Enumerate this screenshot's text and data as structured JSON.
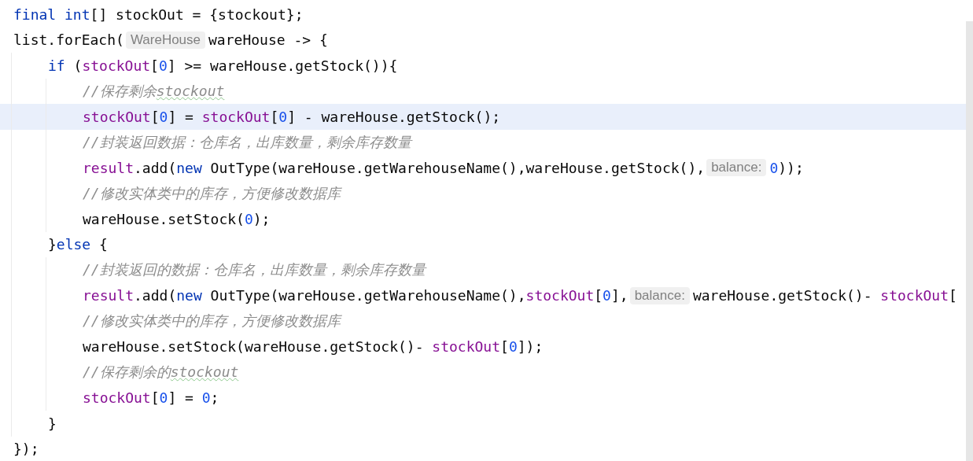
{
  "editor": {
    "lines": [
      {
        "current": false,
        "tokens": [
          {
            "kind": "keyword",
            "text": "final int"
          },
          {
            "kind": "plain",
            "text": "[] stockOut = {stockout};"
          }
        ]
      },
      {
        "current": false,
        "tokens": [
          {
            "kind": "plain",
            "text": "list.forEach("
          },
          {
            "kind": "hint",
            "text": "WareHouse"
          },
          {
            "kind": "plain",
            "text": "wareHouse -> {"
          }
        ],
        "children": [
          {
            "current": false,
            "tokens": [
              {
                "kind": "keyword",
                "text": "if"
              },
              {
                "kind": "plain",
                "text": " ("
              },
              {
                "kind": "field",
                "text": "stockOut"
              },
              {
                "kind": "plain",
                "text": "["
              },
              {
                "kind": "number",
                "text": "0"
              },
              {
                "kind": "plain",
                "text": "] >= wareHouse.getStock()){"
              }
            ],
            "children": [
              {
                "current": false,
                "tokens": [
                  {
                    "kind": "comment",
                    "text": "//保存剩余"
                  },
                  {
                    "kind": "typo",
                    "text": "stockout"
                  }
                ]
              },
              {
                "current": true,
                "tokens": [
                  {
                    "kind": "field",
                    "text": "stockOut"
                  },
                  {
                    "kind": "plain",
                    "text": "["
                  },
                  {
                    "kind": "number",
                    "text": "0"
                  },
                  {
                    "kind": "plain",
                    "text": "] = "
                  },
                  {
                    "kind": "field",
                    "text": "stockOut"
                  },
                  {
                    "kind": "plain",
                    "text": "["
                  },
                  {
                    "kind": "number",
                    "text": "0"
                  },
                  {
                    "kind": "plain",
                    "text": "] - wareHouse.getStock();"
                  }
                ]
              },
              {
                "current": false,
                "tokens": [
                  {
                    "kind": "comment",
                    "text": "//封装返回数据：仓库名，出库数量，剩余库存数量"
                  }
                ]
              },
              {
                "current": false,
                "tokens": [
                  {
                    "kind": "field",
                    "text": "result"
                  },
                  {
                    "kind": "plain",
                    "text": ".add("
                  },
                  {
                    "kind": "keyword",
                    "text": "new"
                  },
                  {
                    "kind": "plain",
                    "text": " OutType(wareHouse.getWarehouseName(),wareHouse.getStock(),"
                  },
                  {
                    "kind": "hint",
                    "text": "balance:"
                  },
                  {
                    "kind": "number",
                    "text": "0"
                  },
                  {
                    "kind": "plain",
                    "text": "));"
                  }
                ]
              },
              {
                "current": false,
                "tokens": [
                  {
                    "kind": "comment",
                    "text": "//修改实体类中的库存，方便修改数据库"
                  }
                ]
              },
              {
                "current": false,
                "tokens": [
                  {
                    "kind": "plain",
                    "text": "wareHouse.setStock("
                  },
                  {
                    "kind": "number",
                    "text": "0"
                  },
                  {
                    "kind": "plain",
                    "text": ");"
                  }
                ]
              }
            ]
          },
          {
            "current": false,
            "tokens": [
              {
                "kind": "plain",
                "text": "}"
              },
              {
                "kind": "keyword",
                "text": "else"
              },
              {
                "kind": "plain",
                "text": " {"
              }
            ],
            "children": [
              {
                "current": false,
                "tokens": [
                  {
                    "kind": "comment",
                    "text": "//封装返回的数据：仓库名，出库数量，剩余库存数量"
                  }
                ]
              },
              {
                "current": false,
                "tokens": [
                  {
                    "kind": "field",
                    "text": "result"
                  },
                  {
                    "kind": "plain",
                    "text": ".add("
                  },
                  {
                    "kind": "keyword",
                    "text": "new"
                  },
                  {
                    "kind": "plain",
                    "text": " OutType(wareHouse.getWarehouseName(),"
                  },
                  {
                    "kind": "field",
                    "text": "stockOut"
                  },
                  {
                    "kind": "plain",
                    "text": "["
                  },
                  {
                    "kind": "number",
                    "text": "0"
                  },
                  {
                    "kind": "plain",
                    "text": "],"
                  },
                  {
                    "kind": "hint",
                    "text": "balance:"
                  },
                  {
                    "kind": "plain",
                    "text": "wareHouse.getStock()- "
                  },
                  {
                    "kind": "field",
                    "text": "stockOut"
                  },
                  {
                    "kind": "plain",
                    "text": "["
                  }
                ]
              },
              {
                "current": false,
                "tokens": [
                  {
                    "kind": "comment",
                    "text": "//修改实体类中的库存，方便修改数据库"
                  }
                ]
              },
              {
                "current": false,
                "tokens": [
                  {
                    "kind": "plain",
                    "text": "wareHouse.setStock(wareHouse.getStock()- "
                  },
                  {
                    "kind": "field",
                    "text": "stockOut"
                  },
                  {
                    "kind": "plain",
                    "text": "["
                  },
                  {
                    "kind": "number",
                    "text": "0"
                  },
                  {
                    "kind": "plain",
                    "text": "]);"
                  }
                ]
              },
              {
                "current": false,
                "tokens": [
                  {
                    "kind": "comment",
                    "text": "//保存剩余的"
                  },
                  {
                    "kind": "typo",
                    "text": "stockout"
                  }
                ]
              },
              {
                "current": false,
                "tokens": [
                  {
                    "kind": "field",
                    "text": "stockOut"
                  },
                  {
                    "kind": "plain",
                    "text": "["
                  },
                  {
                    "kind": "number",
                    "text": "0"
                  },
                  {
                    "kind": "plain",
                    "text": "] = "
                  },
                  {
                    "kind": "number",
                    "text": "0"
                  },
                  {
                    "kind": "plain",
                    "text": ";"
                  }
                ]
              }
            ]
          },
          {
            "current": false,
            "tokens": [
              {
                "kind": "plain",
                "text": "}"
              }
            ]
          }
        ]
      },
      {
        "current": false,
        "tokens": [
          {
            "kind": "plain",
            "text": "});"
          }
        ]
      }
    ]
  }
}
